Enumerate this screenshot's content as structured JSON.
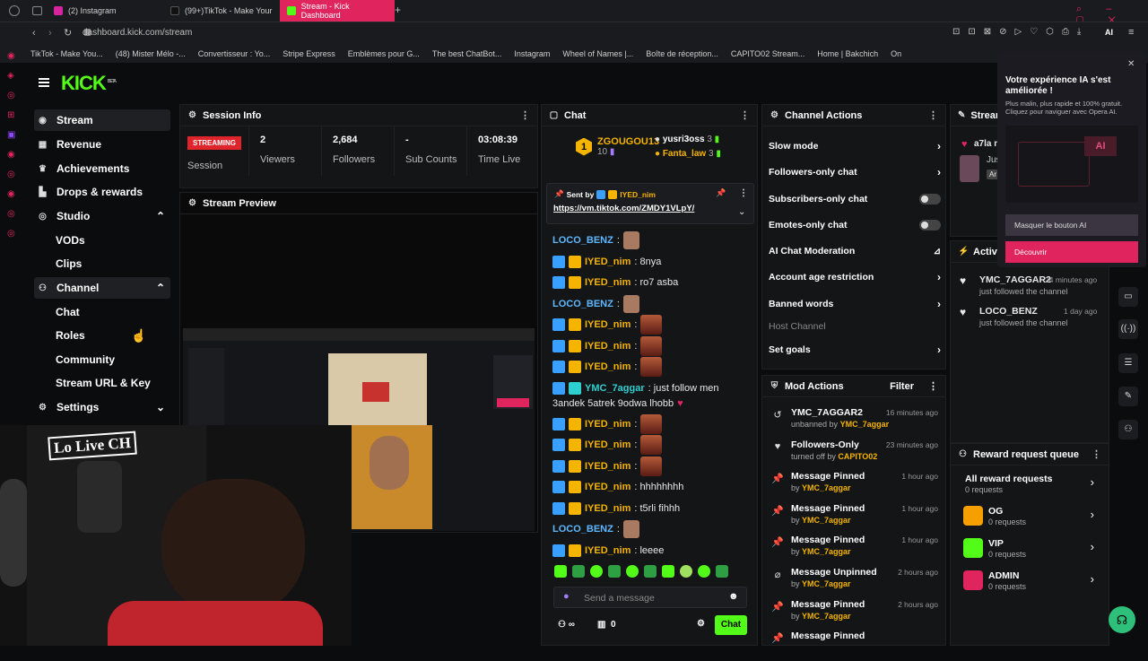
{
  "browser": {
    "tabs": [
      {
        "label": "(2) Instagram"
      },
      {
        "label": "(99+)TikTok - Make Your"
      },
      {
        "label": "Stream - Kick Dashboard"
      }
    ],
    "url": "dashboard.kick.com/stream",
    "ai_label": "AI",
    "bookmarks": [
      "TikTok - Make You...",
      "(48) Mister Mélo -...",
      "Convertisseur : Yo...",
      "Stripe Express",
      "Emblèmes pour G...",
      "The best ChatBot...",
      "Instagram",
      "Wheel of Names |...",
      "Boîte de réception...",
      "CAPITO02 Stream...",
      "Home | Bakchich",
      "On"
    ]
  },
  "sidebar": {
    "logo": "KICK",
    "logo_badge": "BETA",
    "items": [
      {
        "label": "Stream"
      },
      {
        "label": "Revenue"
      },
      {
        "label": "Achievements"
      },
      {
        "label": "Drops & rewards"
      },
      {
        "label": "Studio"
      },
      {
        "label": "VODs"
      },
      {
        "label": "Clips"
      },
      {
        "label": "Channel"
      },
      {
        "label": "Chat"
      },
      {
        "label": "Roles"
      },
      {
        "label": "Community"
      },
      {
        "label": "Stream URL & Key"
      },
      {
        "label": "Settings"
      }
    ]
  },
  "session": {
    "title": "Session Info",
    "status": "STREAMING",
    "status_label": "Session",
    "stats": [
      {
        "value": "2",
        "label": "Viewers"
      },
      {
        "value": "2,684",
        "label": "Followers"
      },
      {
        "value": "-",
        "label": "Sub Counts"
      },
      {
        "value": "03:08:39",
        "label": "Time Live"
      }
    ]
  },
  "preview": {
    "title": "Stream Preview",
    "overlay_text": "Lo Live CH"
  },
  "chat": {
    "title": "Chat",
    "gifter": {
      "rank": "1",
      "name": "ZGOUGOU13",
      "count": "10"
    },
    "gifters": [
      {
        "name": "yusri3oss",
        "count": "3"
      },
      {
        "name": "Fanta_law",
        "count": "3"
      }
    ],
    "pinned": {
      "sent_by": "Sent by",
      "user": "IYED_nim",
      "link": "https://vm.tiktok.com/ZMDY1VLpY/"
    },
    "messages": [
      {
        "user": "LOCO_BENZ",
        "text": ":",
        "type": "loco"
      },
      {
        "user": "IYED_nim",
        "text": ": 8nya",
        "type": "iyed"
      },
      {
        "user": "IYED_nim",
        "text": ": ro7 asba",
        "type": "iyed"
      },
      {
        "user": "LOCO_BENZ",
        "text": ":",
        "type": "loco"
      },
      {
        "user": "IYED_nim",
        "text": ":",
        "type": "iyed"
      },
      {
        "user": "IYED_nim",
        "text": ":",
        "type": "iyed"
      },
      {
        "user": "IYED_nim",
        "text": ":",
        "type": "iyed"
      },
      {
        "user": "YMC_7aggar",
        "text": ": just follow men",
        "text2": "3andek 5atrek 9odwa lhobb",
        "type": "ymc"
      },
      {
        "user": "IYED_nim",
        "text": ":",
        "type": "iyed"
      },
      {
        "user": "IYED_nim",
        "text": ":",
        "type": "iyed"
      },
      {
        "user": "IYED_nim",
        "text": ":",
        "type": "iyed"
      },
      {
        "user": "IYED_nim",
        "text": ": hhhhhhhh",
        "type": "iyed"
      },
      {
        "user": "IYED_nim",
        "text": ": t5rli fihhh",
        "type": "iyed"
      },
      {
        "user": "LOCO_BENZ",
        "text": ":",
        "type": "loco"
      },
      {
        "user": "IYED_nim",
        "text": ": leeee",
        "type": "iyed"
      }
    ],
    "input_placeholder": "Send a message",
    "viewer_count": "0",
    "send_label": "Chat"
  },
  "channel_actions": {
    "title": "Channel Actions",
    "items": [
      {
        "label": "Slow mode",
        "ctrl": "chevron"
      },
      {
        "label": "Followers-only chat",
        "ctrl": "chevron"
      },
      {
        "label": "Subscribers-only chat",
        "ctrl": "toggle"
      },
      {
        "label": "Emotes-only chat",
        "ctrl": "toggle"
      },
      {
        "label": "AI Chat Moderation",
        "ctrl": "chart"
      },
      {
        "label": "Account age restriction",
        "ctrl": "chevron"
      },
      {
        "label": "Banned words",
        "ctrl": "chevron"
      },
      {
        "label": "Host Channel",
        "ctrl": "none"
      },
      {
        "label": "Set goals",
        "ctrl": "chevron"
      }
    ]
  },
  "mod_actions": {
    "title": "Mod Actions",
    "filter": "Filter",
    "items": [
      {
        "title": "YMC_7AGGAR2",
        "prefix": "unbanned by",
        "by": "YMC_7aggar",
        "when": "16 minutes ago",
        "icon": "↺"
      },
      {
        "title": "Followers-Only",
        "prefix": "turned off by",
        "by": "CAPITO02",
        "when": "23 minutes ago",
        "icon": "♥"
      },
      {
        "title": "Message Pinned",
        "prefix": "by",
        "by": "YMC_7aggar",
        "when": "1 hour ago",
        "icon": "📌"
      },
      {
        "title": "Message Pinned",
        "prefix": "by",
        "by": "YMC_7aggar",
        "when": "1 hour ago",
        "icon": "📌"
      },
      {
        "title": "Message Pinned",
        "prefix": "by",
        "by": "YMC_7aggar",
        "when": "1 hour ago",
        "icon": "📌"
      },
      {
        "title": "Message Unpinned",
        "prefix": "by",
        "by": "YMC_7aggar",
        "when": "2 hours ago",
        "icon": "⌀"
      },
      {
        "title": "Message Pinned",
        "prefix": "by",
        "by": "YMC_7aggar",
        "when": "2 hours ago",
        "icon": "📌"
      },
      {
        "title": "Message Pinned",
        "prefix": "",
        "by": "",
        "when": "",
        "icon": "📌"
      }
    ]
  },
  "stream_panel": {
    "title": "Stream",
    "user": "a7la n",
    "sub": "Jus",
    "badge": "Ar"
  },
  "activity": {
    "title": "Activity",
    "items": [
      {
        "name": "YMC_7AGGAR2",
        "text": "just followed the channel",
        "when": "24 minutes ago"
      },
      {
        "name": "LOCO_BENZ",
        "text": "just followed the channel",
        "when": "1 day ago"
      }
    ]
  },
  "rewards": {
    "title": "Reward request queue",
    "items": [
      {
        "name": "All reward requests",
        "count": "0 requests",
        "color": ""
      },
      {
        "name": "OG",
        "count": "0 requests",
        "color": "#f5a000"
      },
      {
        "name": "VIP",
        "count": "0 requests",
        "color": "#53fc18"
      },
      {
        "name": "ADMIN",
        "count": "0 requests",
        "color": "#e0245e"
      }
    ]
  },
  "ai_popup": {
    "title": "Votre expérience IA s'est améliorée !",
    "text": "Plus malin, plus rapide et 100% gratuit. Cliquez pour naviguer avec Opera AI.",
    "badge": "AI",
    "hide_label": "Masquer le bouton AI",
    "discover_label": "Découvrir"
  }
}
